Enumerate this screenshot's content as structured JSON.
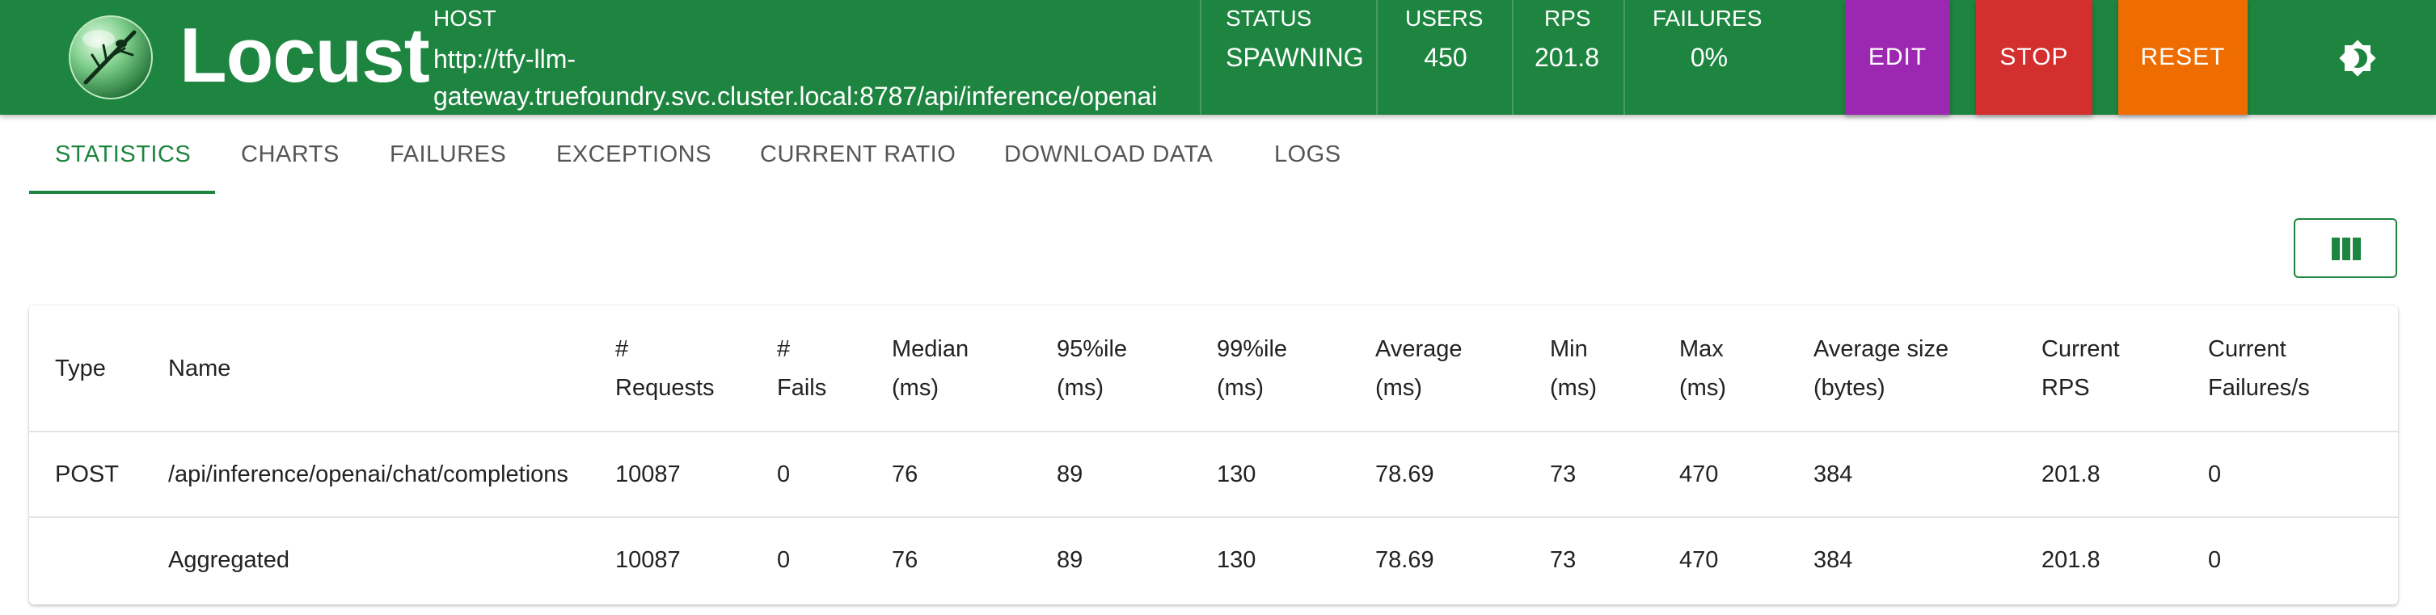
{
  "app": {
    "name": "Locust"
  },
  "header": {
    "host_label": "HOST",
    "host_value": "http://tfy-llm-gateway.truefoundry.svc.cluster.local:8787/api/inference/openai",
    "status_label": "STATUS",
    "status_value": "SPAWNING",
    "users_label": "USERS",
    "users_value": "450",
    "rps_label": "RPS",
    "rps_value": "201.8",
    "failures_label": "FAILURES",
    "failures_value": "0%",
    "buttons": {
      "edit": "EDIT",
      "stop": "STOP",
      "reset": "RESET"
    },
    "colors": {
      "header_bg": "#1e8540",
      "edit": "#9c27b0",
      "stop": "#d32f2f",
      "reset": "#ef6c00"
    },
    "icons": [
      "locust-logo-icon",
      "theme-toggle-icon"
    ]
  },
  "tabs": [
    {
      "label": "STATISTICS",
      "active": true
    },
    {
      "label": "CHARTS",
      "active": false
    },
    {
      "label": "FAILURES",
      "active": false
    },
    {
      "label": "EXCEPTIONS",
      "active": false
    },
    {
      "label": "CURRENT RATIO",
      "active": false
    },
    {
      "label": "DOWNLOAD DATA",
      "active": false
    },
    {
      "label": "LOGS",
      "active": false
    }
  ],
  "toolbar": {
    "columns_icon": "view-column-icon"
  },
  "table": {
    "columns": [
      {
        "line1": "Type",
        "line2": ""
      },
      {
        "line1": "Name",
        "line2": ""
      },
      {
        "line1": "#",
        "line2": "Requests"
      },
      {
        "line1": "#",
        "line2": "Fails"
      },
      {
        "line1": "Median",
        "line2": "(ms)"
      },
      {
        "line1": "95%ile",
        "line2": "(ms)"
      },
      {
        "line1": "99%ile",
        "line2": "(ms)"
      },
      {
        "line1": "Average",
        "line2": "(ms)"
      },
      {
        "line1": "Min",
        "line2": "(ms)"
      },
      {
        "line1": "Max",
        "line2": "(ms)"
      },
      {
        "line1": "Average size",
        "line2": "(bytes)"
      },
      {
        "line1": "Current",
        "line2": "RPS"
      },
      {
        "line1": "Current",
        "line2": "Failures/s"
      }
    ],
    "rows": [
      [
        "POST",
        "/api/inference/openai/chat/completions",
        "10087",
        "0",
        "76",
        "89",
        "130",
        "78.69",
        "73",
        "470",
        "384",
        "201.8",
        "0"
      ],
      [
        "",
        "Aggregated",
        "10087",
        "0",
        "76",
        "89",
        "130",
        "78.69",
        "73",
        "470",
        "384",
        "201.8",
        "0"
      ]
    ]
  }
}
